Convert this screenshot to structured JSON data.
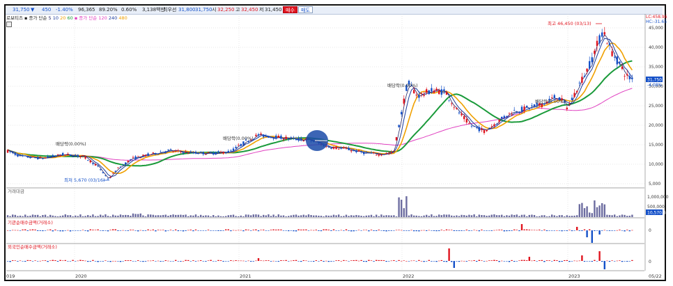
{
  "toolbar": {
    "price": "31,750",
    "arrow": "▼",
    "change": "450",
    "change_pct": "-1.40%",
    "volume": "96,365",
    "turnover_pct": "89.20%",
    "ratio": "0.60%",
    "trade_value": "3,138백만",
    "priority": "최우선",
    "ask_price": "31,800",
    "bid_price": "31,750",
    "open_label": "시",
    "open": "32,250",
    "high_label": "고",
    "high": "32,450",
    "low_label": "저",
    "low": "31,450",
    "buy_label": "매수",
    "sell_label": "매도"
  },
  "legend": {
    "price_title": "로보티즈 ▪ 종가 단순",
    "ma_short": [
      "5",
      "10",
      "20",
      "60"
    ],
    "ma_short_label": "▪ 종가 단순",
    "ma_long": [
      "120",
      "240",
      "480"
    ],
    "volume_title": "거래대금",
    "inst_title": "기관순매수금액(거래소)",
    "foreign_title": "외국인순매수금액(거래소)"
  },
  "colors": {
    "up": "#e0141e",
    "down": "#1450c8",
    "ma5": "#222266",
    "ma10": "#1a3a9c",
    "ma20": "#f0a000",
    "ma60": "#1a9a3a",
    "ma120": "#e040c0",
    "volume": "#6c6ca0",
    "annot_red": "#e0141e",
    "annot_blue": "#1450c8",
    "highlight": "#1a4aa8"
  },
  "annotations": {
    "high": "최고 46,450 (03/13)",
    "low": "최저 5,670 (03/16)",
    "div1": "배당락(0.00%)",
    "div2": "배당락(0.00%)",
    "div3": "배당락(0.00%)",
    "div4": "배당락(0.00%)"
  },
  "price_axis": [
    "45,000",
    "40,000",
    "35,000",
    "30,000",
    "25,000",
    "20,000",
    "15,000",
    "10,000",
    "5,000"
  ],
  "price_axis_right_labels": [
    "LC:458.96",
    "HC:-31.65"
  ],
  "last_price_tag": "31,750",
  "last_pct_tag": "-4.08%",
  "volume_axis": [
    "1,000,000",
    "500,000"
  ],
  "volume_tag": "10,570.64",
  "inst_axis": "0",
  "foreign_axis": "0",
  "x_axis": [
    "019",
    "2020",
    "2021",
    "2022",
    "2023",
    "05/22"
  ],
  "chart_data": {
    "type": "candlestick",
    "title": "",
    "xlabel": "",
    "ylabel": "",
    "x_years": [
      "2019",
      "2020",
      "2021",
      "2022",
      "2023"
    ],
    "ylim": [
      5000,
      47000
    ],
    "series_approx_close": [
      {
        "date": "2019-06",
        "value": 15000
      },
      {
        "date": "2019-09",
        "value": 12000
      },
      {
        "date": "2019-12",
        "value": 11500
      },
      {
        "date": "2020-03",
        "value": 5670
      },
      {
        "date": "2020-06",
        "value": 11000
      },
      {
        "date": "2020-09",
        "value": 13000
      },
      {
        "date": "2020-12",
        "value": 12500
      },
      {
        "date": "2021-03",
        "value": 17500
      },
      {
        "date": "2021-06",
        "value": 16000
      },
      {
        "date": "2021-09",
        "value": 13000
      },
      {
        "date": "2021-12",
        "value": 14000
      },
      {
        "date": "2022-01",
        "value": 29000
      },
      {
        "date": "2022-04",
        "value": 28000
      },
      {
        "date": "2022-07",
        "value": 18500
      },
      {
        "date": "2022-10",
        "value": 24000
      },
      {
        "date": "2023-01",
        "value": 26000
      },
      {
        "date": "2023-03",
        "value": 46450
      },
      {
        "date": "2023-05",
        "value": 31750
      }
    ],
    "moving_averages": [
      "5",
      "10",
      "20",
      "60",
      "120",
      "240",
      "480"
    ]
  }
}
